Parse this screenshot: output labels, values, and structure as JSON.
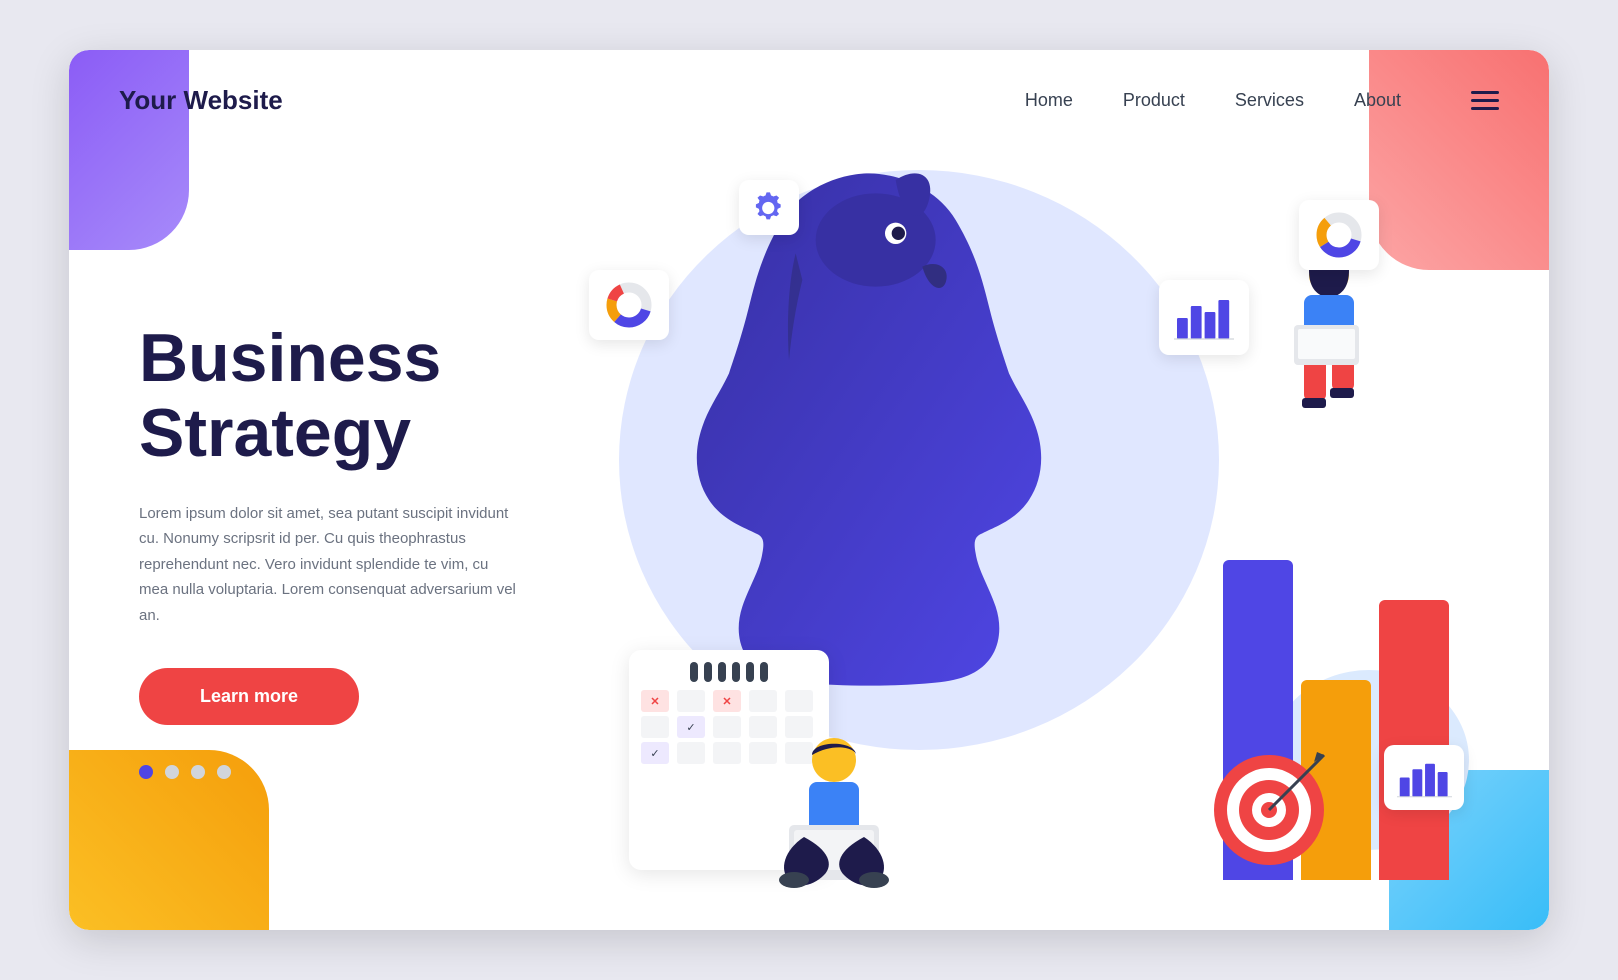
{
  "page": {
    "background": "#e8e8f0"
  },
  "header": {
    "logo": "Your Website",
    "nav": {
      "home": "Home",
      "product": "Product",
      "services": "Services",
      "about": "About"
    }
  },
  "hero": {
    "title_line1": "Business",
    "title_line2": "Strategy",
    "description": "Lorem ipsum dolor sit amet, sea putant suscipit invidunt cu. Nonumy scripsrit id per. Cu quis theophrastus reprehendunt nec. Vero invidunt splendide te vim, cu mea nulla voluptaria. Lorem consenquat adversarium vel an.",
    "cta_button": "Learn more",
    "dots_count": 4
  },
  "colors": {
    "primary": "#4f46e5",
    "accent_red": "#ef4444",
    "accent_orange": "#f59e0b",
    "text_dark": "#1e1b4b",
    "text_gray": "#6b7280"
  }
}
